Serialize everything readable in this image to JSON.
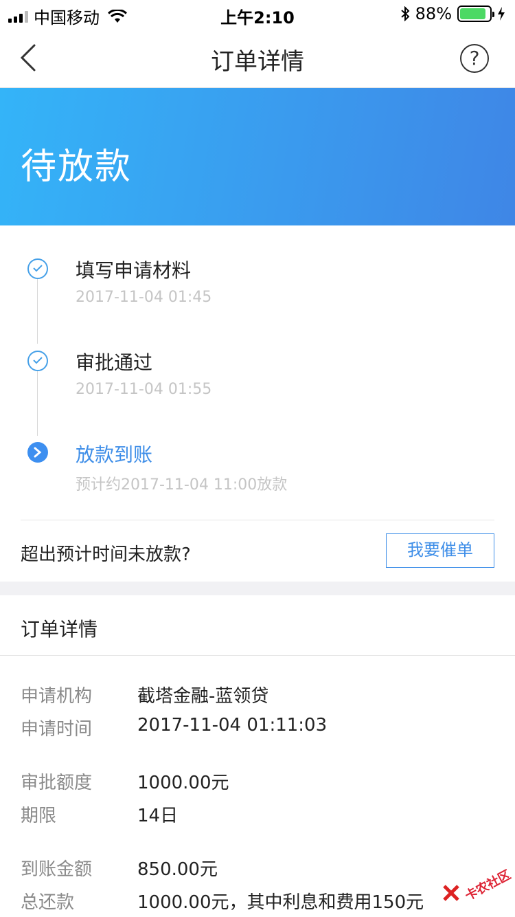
{
  "status_bar": {
    "carrier": "中国移动",
    "time": "上午2:10",
    "battery": "88%",
    "battery_level": 0.88
  },
  "nav": {
    "title": "订单详情",
    "help_icon_text": "?"
  },
  "banner": {
    "status": "待放款",
    "colors": [
      "#34b4f8",
      "#3f86e6"
    ]
  },
  "timeline": [
    {
      "title": "填写申请材料",
      "time": "2017-11-04 01:45",
      "state": "done"
    },
    {
      "title": "审批通过",
      "time": "2017-11-04 01:55",
      "state": "done"
    },
    {
      "title": "放款到账",
      "time": "预计约2017-11-04 11:00放款",
      "state": "current"
    }
  ],
  "urge": {
    "question": "超出预计时间未放款?",
    "button_label": "我要催单"
  },
  "details": {
    "section_title": "订单详情",
    "rows": [
      {
        "label": "申请机构",
        "value": "截塔金融-蓝领贷"
      },
      {
        "label": "申请时间",
        "value": "2017-11-04 01:11:03"
      },
      {
        "label": "审批额度",
        "value": "1000.00元"
      },
      {
        "label": "期限",
        "value": "14日"
      },
      {
        "label": "到账金额",
        "value": "850.00元"
      },
      {
        "label": "总还款",
        "value": "1000.00元，其中利息和费用150元"
      }
    ]
  },
  "watermark": "卡农社区",
  "accent_color": "#3e8ee8"
}
